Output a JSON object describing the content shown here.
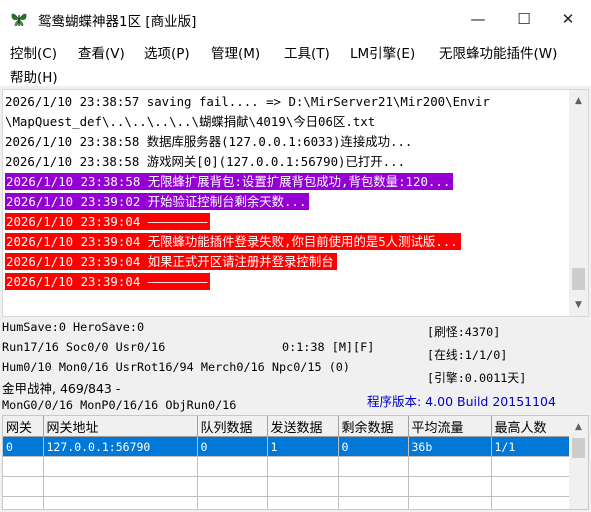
{
  "window": {
    "title": "鸳鸯蝴蝶神器1区 [商业版]",
    "controls": {
      "minimize": "—",
      "maximize": "☐",
      "close": "✕"
    }
  },
  "menu": [
    "控制(C)",
    "查看(V)",
    "选项(P)",
    "管理(M)",
    "工具(T)",
    "LM引擎(E)",
    "无限蜂功能插件(W)",
    "帮助(H)"
  ],
  "log": {
    "lines": [
      {
        "text": "2026/1/10 23:38:57 saving fail.... => D:\\MirServer21\\Mir200\\Envir"
      },
      {
        "text": "\\MapQuest_def\\..\\..\\..\\..\\蝴蝶捐献\\4019\\今日06区.txt"
      },
      {
        "text": "2026/1/10 23:38:58 数据库服务器(127.0.0.1:6033)连接成功..."
      },
      {
        "text": "2026/1/10 23:38:58 游戏网关[0](127.0.0.1:56790)已打开..."
      },
      {
        "text": "2026/1/10 23:38:58 无限蜂扩展背包:设置扩展背包成功,背包数量:120...",
        "highlight": "#9400d3"
      },
      {
        "text": "2026/1/10 23:39:02 开始验证控制台剩余天数...",
        "highlight": "#9400d3"
      },
      {
        "text": "2026/1/10 23:39:04 ————————",
        "highlight": "#ff0000"
      },
      {
        "text": "2026/1/10 23:39:04 无限蜂功能插件登录失败,你目前使用的是5人测试版...",
        "highlight": "#ff0000"
      },
      {
        "text": "2026/1/10 23:39:04 如果正式开区请注册并登录控制台",
        "highlight": "#ff0000"
      },
      {
        "text": "2026/1/10 23:39:04 ————————",
        "highlight": "#ff0000"
      }
    ]
  },
  "status": {
    "save": "HumSave:0 HeroSave:0",
    "run": "Run17/16 Soc0/0 Usr0/16",
    "runtime": "0:1:38 [M][F]",
    "hum": "Hum0/10 Mon0/16 UsrRot16/94 Merch0/16 Npc0/15 (0)",
    "war": "金甲战神, 469/843 -",
    "mongen": "MonG0/0/16 MonP0/16/16 ObjRun0/16",
    "refresh": "[刷怪:4370]",
    "online": "[在线:1/1/0]",
    "engine": "[引擎:0.0011天]",
    "version": "程序版本: 4.00 Build 20151104",
    "version_color": "#0000cc"
  },
  "gateways": {
    "columns": [
      "网关",
      "网关地址",
      "队列数据",
      "发送数据",
      "剩余数据",
      "平均流量",
      "最高人数"
    ],
    "rows": [
      [
        "0",
        "127.0.0.1:56790",
        "0",
        "1",
        "0",
        "36b",
        "1/1"
      ]
    ]
  },
  "colors": {
    "selection": "#0078d7",
    "purple_highlight": "#9400d3",
    "red_highlight": "#ff0000"
  }
}
